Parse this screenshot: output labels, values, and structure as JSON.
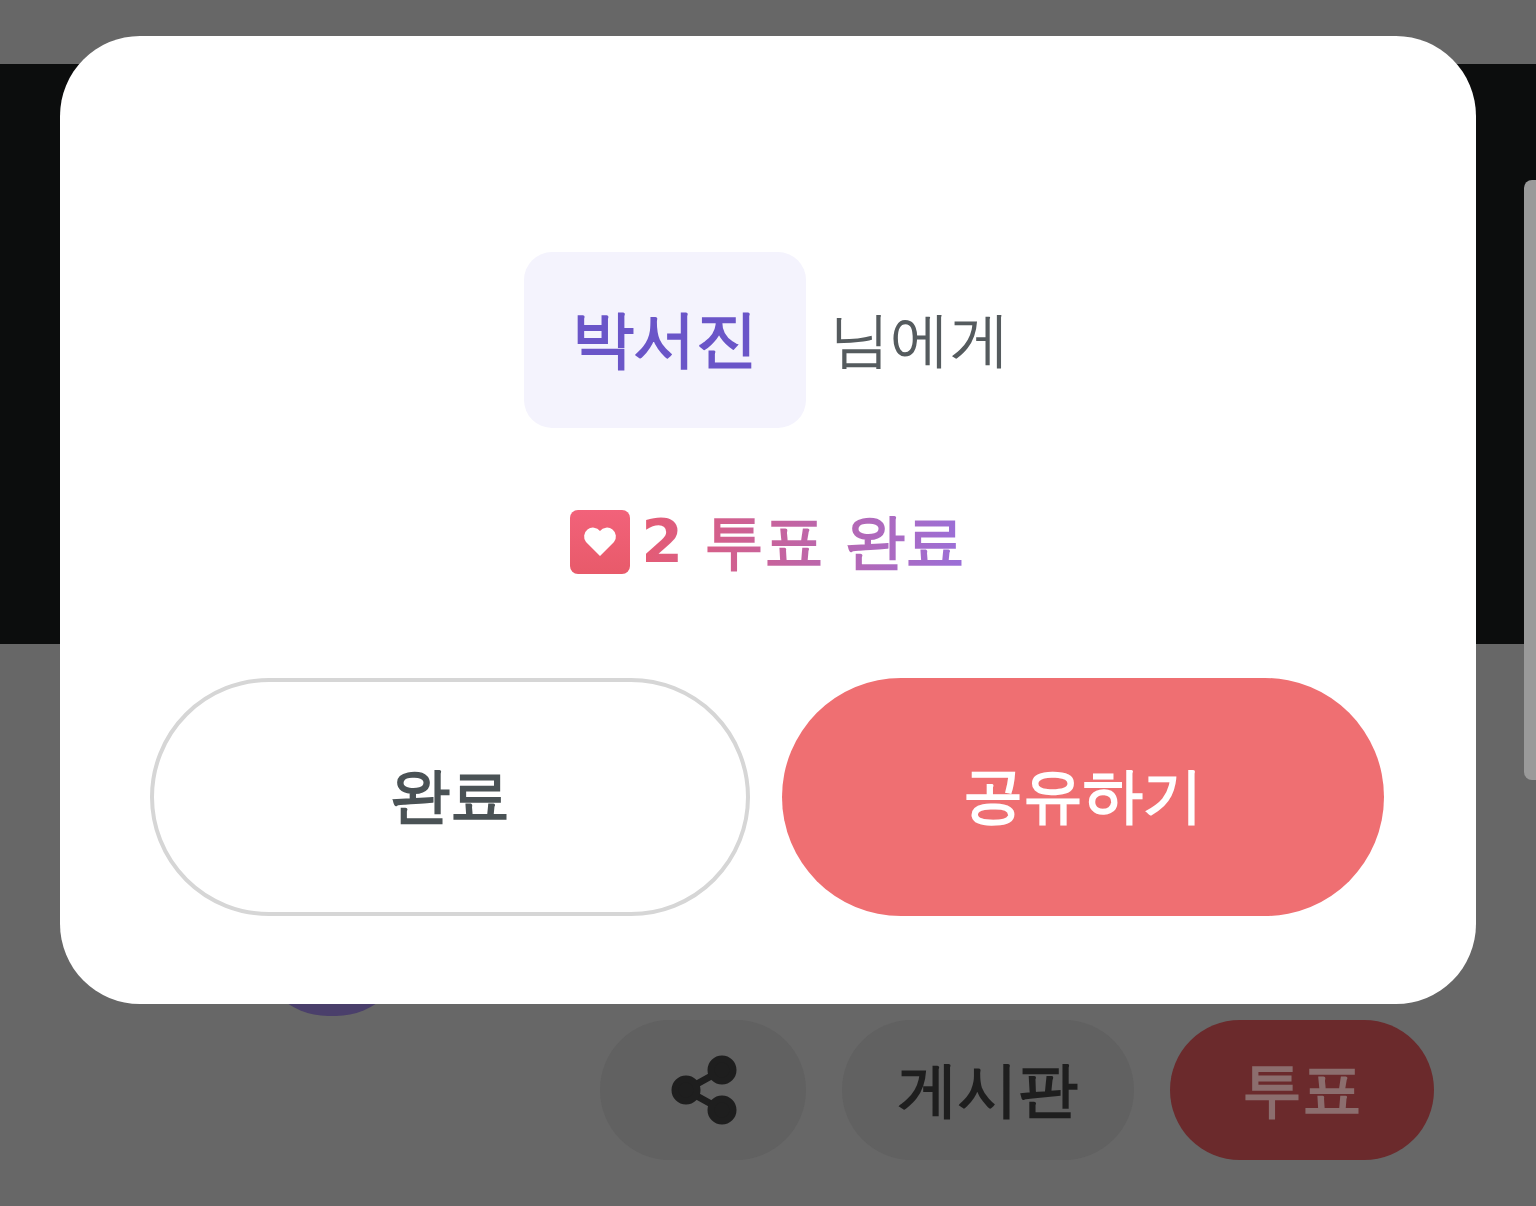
{
  "dialog": {
    "recipient": "박서진",
    "suffix": "님에게",
    "vote_result": "2 투표 완료",
    "buttons": [
      {
        "label": "완료",
        "kind": "secondary"
      },
      {
        "label": "공유하기",
        "kind": "primary"
      }
    ]
  },
  "background_actions": [
    {
      "kind": "share"
    },
    {
      "kind": "plain",
      "label": "게시판"
    },
    {
      "kind": "primary",
      "label": "투표"
    }
  ]
}
